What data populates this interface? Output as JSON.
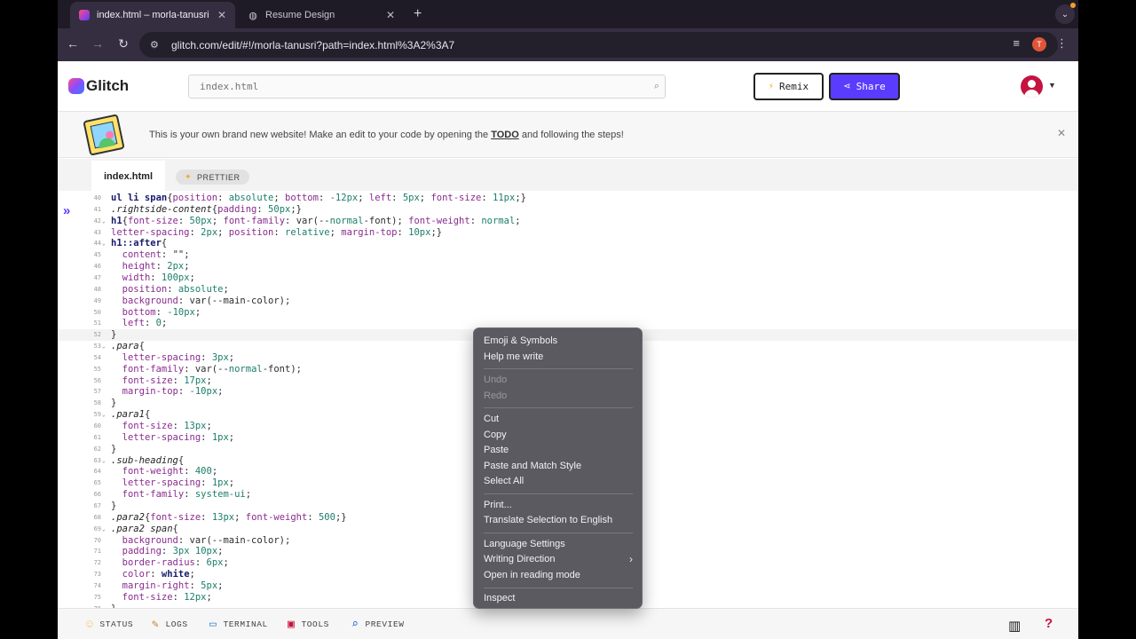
{
  "browser": {
    "tabs": [
      {
        "title": "index.html – morla-tanusri",
        "active": true
      },
      {
        "title": "Resume Design",
        "active": false
      }
    ],
    "new_tab": "+",
    "tab_menu": "⌄",
    "address": "glitch.com/edit/#!/morla-tanusri?path=index.html%3A2%3A7",
    "profile_initial": "T"
  },
  "glitch": {
    "logo_text": "Glitch",
    "search_placeholder": "index.html",
    "remix_label": "Remix",
    "share_label": "Share",
    "banner": {
      "text_before": "This is your own brand new website! Make an edit to your code by opening the ",
      "link": "TODO",
      "text_after": " and following the steps!"
    },
    "file_tab": "index.html",
    "prettier_label": "PRETTIER"
  },
  "editor": {
    "lines": [
      {
        "n": "40",
        "fold": "",
        "code": "ul li span{position: absolute; bottom: -12px; left: 5px; font-size: 11px;}"
      },
      {
        "n": "41",
        "fold": "",
        "code": ".rightside-content{padding: 50px;}"
      },
      {
        "n": "42",
        "fold": "⌄",
        "code": "h1{font-size: 50px; font-family: var(--normal-font); font-weight: normal;"
      },
      {
        "n": "43",
        "fold": "",
        "code": "letter-spacing: 2px; position: relative; margin-top: 10px;}"
      },
      {
        "n": "44",
        "fold": "⌄",
        "code": "h1::after{"
      },
      {
        "n": "45",
        "fold": "",
        "code": "  content: \"\";"
      },
      {
        "n": "46",
        "fold": "",
        "code": "  height: 2px;"
      },
      {
        "n": "47",
        "fold": "",
        "code": "  width: 100px;"
      },
      {
        "n": "48",
        "fold": "",
        "code": "  position: absolute;"
      },
      {
        "n": "49",
        "fold": "",
        "code": "  background: var(--main-color);"
      },
      {
        "n": "50",
        "fold": "",
        "code": "  bottom: -10px;"
      },
      {
        "n": "51",
        "fold": "",
        "code": "  left: 0;"
      },
      {
        "n": "52",
        "fold": "",
        "code": "}"
      },
      {
        "n": "53",
        "fold": "⌄",
        "code": ".para{"
      },
      {
        "n": "54",
        "fold": "",
        "code": "  letter-spacing: 3px;"
      },
      {
        "n": "55",
        "fold": "",
        "code": "  font-family: var(--normal-font);"
      },
      {
        "n": "56",
        "fold": "",
        "code": "  font-size: 17px;"
      },
      {
        "n": "57",
        "fold": "",
        "code": "  margin-top: -10px;"
      },
      {
        "n": "58",
        "fold": "",
        "code": "}"
      },
      {
        "n": "59",
        "fold": "⌄",
        "code": ".para1{"
      },
      {
        "n": "60",
        "fold": "",
        "code": "  font-size: 13px;"
      },
      {
        "n": "61",
        "fold": "",
        "code": "  letter-spacing: 1px;"
      },
      {
        "n": "62",
        "fold": "",
        "code": "}"
      },
      {
        "n": "63",
        "fold": "⌄",
        "code": ".sub-heading{"
      },
      {
        "n": "64",
        "fold": "",
        "code": "  font-weight: 400;"
      },
      {
        "n": "65",
        "fold": "",
        "code": "  letter-spacing: 1px;"
      },
      {
        "n": "66",
        "fold": "",
        "code": "  font-family: system-ui;"
      },
      {
        "n": "67",
        "fold": "",
        "code": "}"
      },
      {
        "n": "68",
        "fold": "",
        "code": ".para2{font-size: 13px; font-weight: 500;}"
      },
      {
        "n": "69",
        "fold": "⌄",
        "code": ".para2 span{"
      },
      {
        "n": "70",
        "fold": "",
        "code": "  background: var(--main-color);"
      },
      {
        "n": "71",
        "fold": "",
        "code": "  padding: 3px 10px;"
      },
      {
        "n": "72",
        "fold": "",
        "code": "  border-radius: 6px;"
      },
      {
        "n": "73",
        "fold": "",
        "code": "  color: white;"
      },
      {
        "n": "74",
        "fold": "",
        "code": "  margin-right: 5px;"
      },
      {
        "n": "75",
        "fold": "",
        "code": "  font-size: 12px;"
      },
      {
        "n": "76",
        "fold": "",
        "code": "}"
      }
    ]
  },
  "context_menu": {
    "items": [
      {
        "label": "Emoji & Symbols",
        "disabled": false
      },
      {
        "label": "Help me write",
        "disabled": false
      },
      {
        "label": "Undo",
        "disabled": true
      },
      {
        "label": "Redo",
        "disabled": true
      },
      {
        "label": "Cut",
        "disabled": false
      },
      {
        "label": "Copy",
        "disabled": false
      },
      {
        "label": "Paste",
        "disabled": false
      },
      {
        "label": "Paste and Match Style",
        "disabled": false
      },
      {
        "label": "Select All",
        "disabled": false
      },
      {
        "label": "Print...",
        "disabled": false
      },
      {
        "label": "Translate Selection to English",
        "disabled": false
      },
      {
        "label": "Language Settings",
        "disabled": false
      },
      {
        "label": "Writing Direction",
        "disabled": false,
        "submenu": true
      },
      {
        "label": "Open in reading mode",
        "disabled": false
      },
      {
        "label": "Inspect",
        "disabled": false
      }
    ]
  },
  "footer": {
    "status": "STATUS",
    "logs": "LOGS",
    "terminal": "TERMINAL",
    "tools": "TOOLS",
    "preview": "PREVIEW"
  },
  "colors": {
    "accent": "#5a3cff",
    "avatar": "#c5123f",
    "menu_bg": "#5c5a61"
  }
}
